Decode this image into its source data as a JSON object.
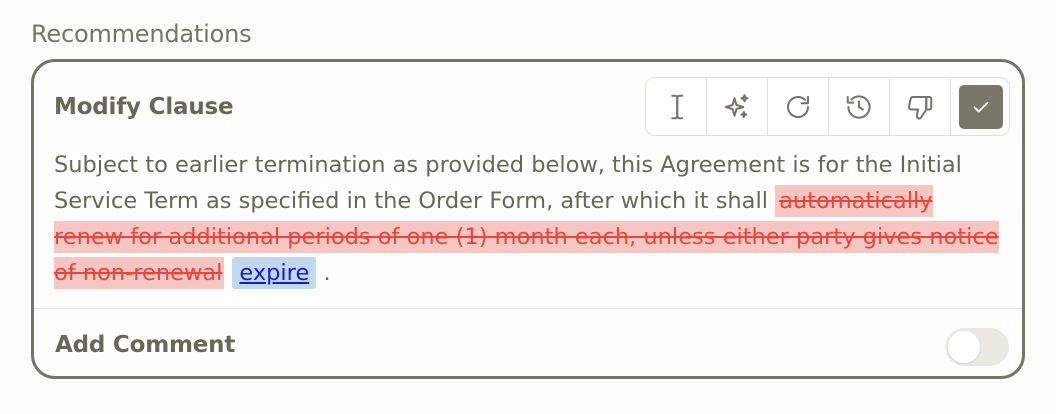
{
  "section": {
    "title": "Recommendations"
  },
  "card": {
    "title": "Modify Clause",
    "toolbar": {
      "tools": [
        {
          "icon": "text-cursor-icon"
        },
        {
          "icon": "sparkles-icon"
        },
        {
          "icon": "refresh-icon"
        },
        {
          "icon": "history-icon"
        },
        {
          "icon": "thumbs-down-icon"
        },
        {
          "icon": "check-icon",
          "selected": true
        }
      ]
    },
    "clause": {
      "prefix": "Subject to earlier termination as provided below, this Agreement is for the Initial Service Term as specified in the Order Form, after which it shall ",
      "deleted": "automatically renew for additional periods of one (1) month each, unless either party gives notice of non-renewal",
      "inserted": "expire",
      "suffix": "."
    },
    "comment": {
      "label": "Add Comment",
      "enabled": false
    }
  },
  "colors": {
    "border": "#77736b",
    "deleted_bg": "#f6c6c3",
    "deleted_text": "#e8453c",
    "inserted_bg": "#bfd9ef",
    "inserted_text": "#1a1ad6",
    "check_bg": "#7a7669"
  }
}
